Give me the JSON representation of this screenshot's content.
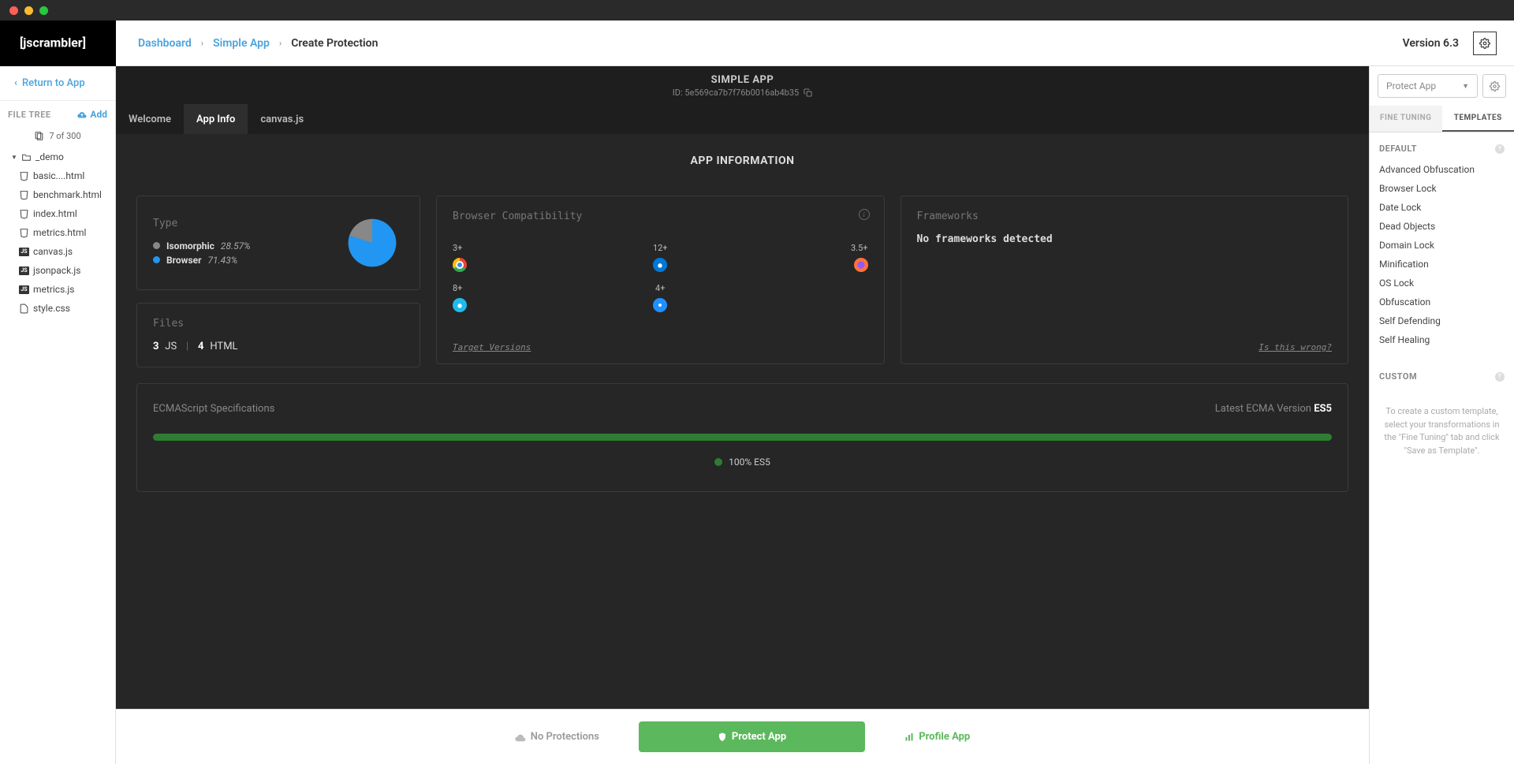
{
  "chrome": {},
  "breadcrumb": {
    "a": "Dashboard",
    "b": "Simple App",
    "c": "Create Protection"
  },
  "header": {
    "version": "Version 6.3"
  },
  "sidebar_left": {
    "return": "Return to App",
    "file_tree_label": "FILE TREE",
    "add_label": "Add",
    "file_count": "7 of 300",
    "folder": "_demo",
    "files": [
      "basic....html",
      "benchmark.html",
      "index.html",
      "metrics.html",
      "canvas.js",
      "jsonpack.js",
      "metrics.js",
      "style.css"
    ]
  },
  "app": {
    "name": "SIMPLE APP",
    "id_label": "ID: 5e569ca7b7f76b0016ab4b35",
    "tabs": [
      "Welcome",
      "App Info",
      "canvas.js"
    ]
  },
  "section_title": "APP INFORMATION",
  "type_card": {
    "label": "Type",
    "iso_label": "Isomorphic",
    "iso_pct": "28.57%",
    "brw_label": "Browser",
    "brw_pct": "71.43%"
  },
  "files_card": {
    "label": "Files",
    "js_n": "3",
    "js_l": "JS",
    "html_n": "4",
    "html_l": "HTML"
  },
  "browser_card": {
    "label": "Browser Compatibility",
    "link": "Target Versions",
    "cells": {
      "chrome": "3+",
      "edge": "12+",
      "ff": "3.5+",
      "ie": "8+",
      "saf": "4+"
    }
  },
  "fw_card": {
    "label": "Frameworks",
    "text": "No frameworks detected",
    "link": "Is this wrong?"
  },
  "ecma": {
    "label": "ECMAScript Specifications",
    "latest_label": "Latest ECMA Version",
    "latest_val": "ES5",
    "prog_label": "100% ES5"
  },
  "footer": {
    "no_prot": "No Protections",
    "protect": "Protect App",
    "profile": "Profile App"
  },
  "sidebar_right": {
    "protect_dd": "Protect App",
    "tabs": {
      "ft": "FINE TUNING",
      "tpl": "TEMPLATES"
    },
    "default_label": "DEFAULT",
    "items": [
      "Advanced Obfuscation",
      "Browser Lock",
      "Date Lock",
      "Dead Objects",
      "Domain Lock",
      "Minification",
      "OS Lock",
      "Obfuscation",
      "Self Defending",
      "Self Healing"
    ],
    "custom_label": "CUSTOM",
    "custom_help": "To create a custom template, select your transformations in the \"Fine Tuning\" tab and click \"Save as Template\"."
  },
  "chart_data": {
    "type": "pie",
    "title": "Type",
    "series": [
      {
        "name": "Isomorphic",
        "value": 28.57,
        "color": "#888888"
      },
      {
        "name": "Browser",
        "value": 71.43,
        "color": "#2196f3"
      }
    ]
  }
}
